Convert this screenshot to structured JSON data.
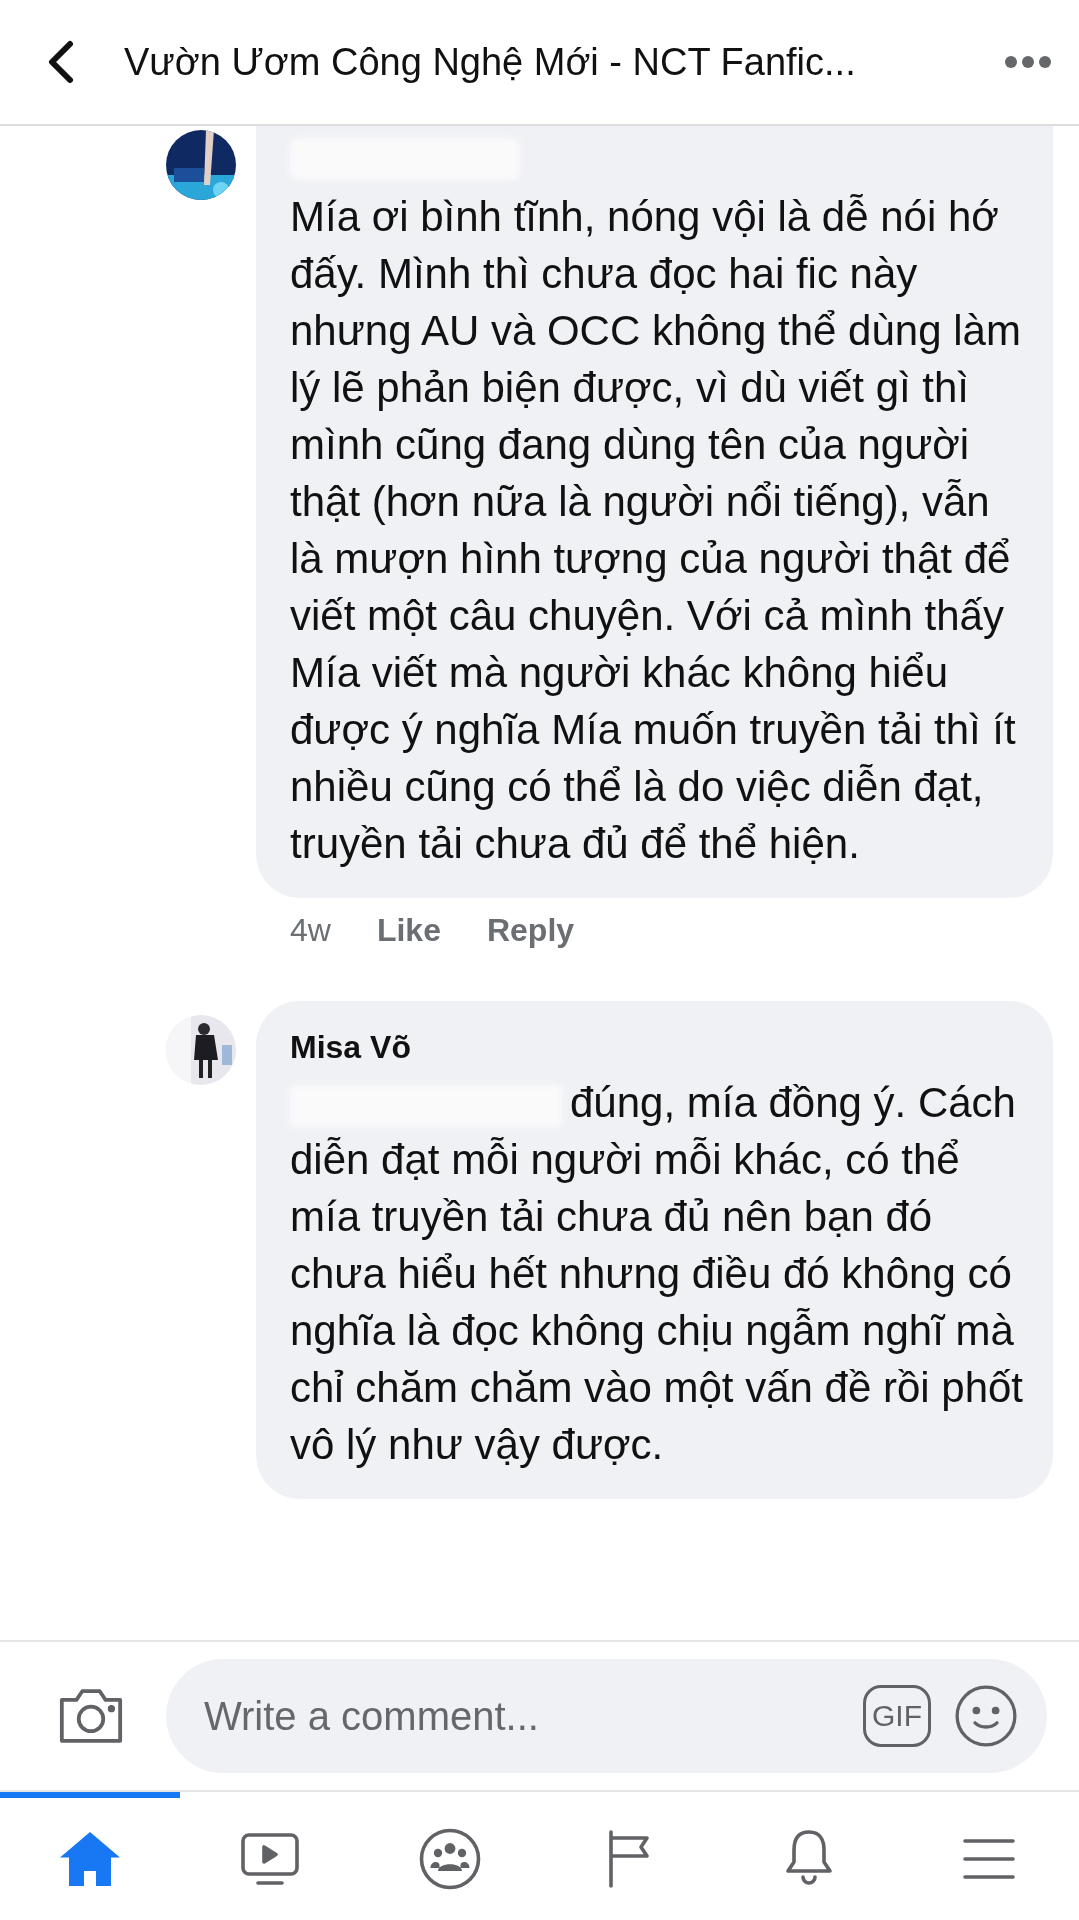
{
  "header": {
    "title": "Vườn Ươm Công Nghệ Mới - NCT Fanfic..."
  },
  "comments": [
    {
      "name_redacted": true,
      "body_redacted_prefix": false,
      "body": "Mía ơi bình tĩnh, nóng vội là dễ nói hớ đấy. Mình thì chưa đọc hai fic này nhưng AU và OCC không thể dùng làm lý lẽ phản biện được, vì dù viết gì thì mình cũng đang dùng tên của người thật (hơn nữa là người nổi tiếng), vẫn là mượn hình tượng của người thật để viết một câu chuyện. Với cả mình thấy Mía viết mà người khác không hiểu được ý nghĩa Mía muốn truyền tải thì ít nhiều cũng có thể là do việc diễn đạt, truyền tải chưa đủ để thể hiện.",
      "time": "4w",
      "actions": [
        "Like",
        "Reply"
      ]
    },
    {
      "name_redacted": false,
      "author": "Misa Võ",
      "body_redacted_prefix": true,
      "body": "đúng, mía đồng ý. Cách diễn đạt mỗi người mỗi khác, có thể mía truyền tải chưa đủ nên bạn đó chưa hiểu hết nhưng điều đó không có nghĩa là đọc không chịu ngẫm nghĩ mà chỉ chăm chăm vào một vấn đề rồi phốt vô lý như vậy được."
    }
  ],
  "composer": {
    "placeholder": "Write a comment...",
    "gif_label": "GIF"
  },
  "tabs": [
    {
      "kind": "home",
      "selected": true
    },
    {
      "kind": "video",
      "selected": false
    },
    {
      "kind": "groups",
      "selected": false
    },
    {
      "kind": "pages",
      "selected": false
    },
    {
      "kind": "notifications",
      "selected": false
    },
    {
      "kind": "menu",
      "selected": false
    }
  ]
}
